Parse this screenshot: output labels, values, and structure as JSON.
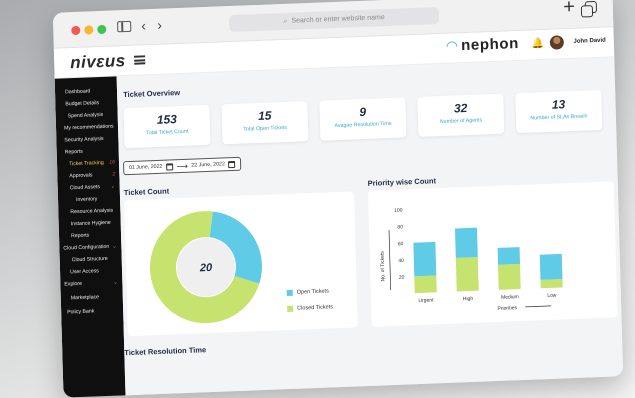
{
  "browser": {
    "address_placeholder": "Search or enter website name",
    "back_icon": "‹",
    "forward_icon": "›",
    "plus_icon": "+"
  },
  "header": {
    "logo": "nivεus",
    "brand": "nephon",
    "brand_icon": "◠",
    "bell_icon": "🔔",
    "user_name": "John David"
  },
  "sidebar": {
    "items": [
      {
        "label": "Dashboard"
      },
      {
        "label": "Budget Details"
      },
      {
        "label": "Spend Analysis"
      },
      {
        "label": "My recommendations"
      },
      {
        "label": "Security Analysis"
      },
      {
        "label": "Reports"
      },
      {
        "label": "Ticket Tracking",
        "badge": "16"
      },
      {
        "label": "Approvals",
        "badge": "2"
      },
      {
        "label": "Cloud Assets",
        "chevron": "⌄"
      },
      {
        "label": "Inventory"
      },
      {
        "label": "Resource Analysis"
      },
      {
        "label": "Instance Hygiene"
      },
      {
        "label": "Reports"
      },
      {
        "label": "Cloud Configuration",
        "chevron": "⌄"
      },
      {
        "label": "Cloud Structure"
      },
      {
        "label": "User Access"
      },
      {
        "label": "Explore",
        "chevron": "⌄"
      },
      {
        "label": "Marketplace"
      },
      {
        "label": "Policy Bank"
      }
    ]
  },
  "main": {
    "overview_title": "Ticket Overview",
    "cards": [
      {
        "value": "153",
        "label": "Total Ticket Count"
      },
      {
        "value": "15",
        "label": "Total Open Tickets"
      },
      {
        "value": "9",
        "label": "Avagae Resolution Time"
      },
      {
        "value": "32",
        "label": "Number of Agents"
      },
      {
        "value": "13",
        "label": "Number of SLAs Breach"
      }
    ],
    "date_start": "01 June, 2022",
    "date_arrow": "⟶",
    "date_end": "22 June, 2022",
    "ticket_count_title": "Ticket Count",
    "priority_title": "Priority wise Count",
    "resolution_title": "Ticket Resolution Time"
  },
  "colors": {
    "open": "#5fcbe6",
    "closed": "#c7e36f",
    "sidebar_bg": "#0f0f10",
    "accent_blue": "#3aa7d6"
  },
  "chart_data": [
    {
      "type": "pie",
      "title": "Ticket Count",
      "center_label": "20",
      "slices": [
        {
          "name": "Open Tickets",
          "value": 28
        },
        {
          "name": "Closed Tickets",
          "value": 72
        }
      ],
      "legend": [
        "Open Tickets",
        "Closed Tickets"
      ]
    },
    {
      "type": "bar",
      "title": "Priority wise Count",
      "categories": [
        "Urgent",
        "High",
        "Medium",
        "Low"
      ],
      "series": [
        {
          "name": "Closed Tickets",
          "values": [
            20,
            40,
            30,
            10
          ]
        },
        {
          "name": "Open Tickets",
          "values": [
            40,
            35,
            20,
            30
          ]
        }
      ],
      "stacked": true,
      "xlabel": "Priorities",
      "ylabel": "No. of Tickets",
      "yticks": [
        20,
        40,
        60,
        80,
        100
      ],
      "ylim": [
        0,
        100
      ]
    }
  ]
}
